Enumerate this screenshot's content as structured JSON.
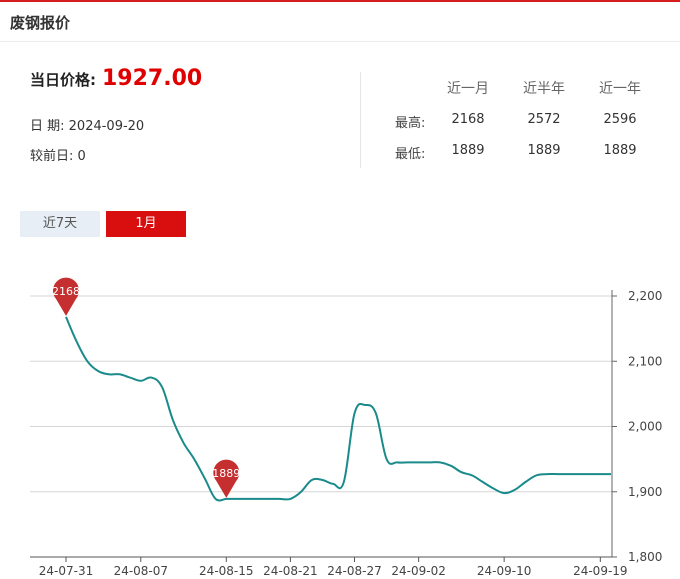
{
  "header": {
    "title": "废钢报价"
  },
  "price": {
    "label": "当日价格:",
    "value": "1927.00"
  },
  "meta": {
    "date_label": "日 期:",
    "date": "2024-09-20",
    "prev_label": "较前日:",
    "prev": "0"
  },
  "stats": {
    "headers": [
      "近一月",
      "近半年",
      "近一年"
    ],
    "high_label": "最高:",
    "low_label": "最低:",
    "high": [
      "2168",
      "2572",
      "2596"
    ],
    "low": [
      "1889",
      "1889",
      "1889"
    ]
  },
  "tabs": [
    {
      "label": "近7天",
      "active": false
    },
    {
      "label": "1月",
      "active": true
    }
  ],
  "colors": {
    "line": "#1a8a8a",
    "marker": "#c62f2f",
    "accent": "#d90e0e"
  },
  "chart_data": {
    "type": "line",
    "x": [
      "24-07-31",
      "24-08-01",
      "24-08-02",
      "24-08-03",
      "24-08-04",
      "24-08-05",
      "24-08-06",
      "24-08-07",
      "24-08-08",
      "24-08-09",
      "24-08-10",
      "24-08-11",
      "24-08-12",
      "24-08-13",
      "24-08-14",
      "24-08-15",
      "24-08-16",
      "24-08-17",
      "24-08-18",
      "24-08-19",
      "24-08-20",
      "24-08-21",
      "24-08-22",
      "24-08-23",
      "24-08-24",
      "24-08-25",
      "24-08-26",
      "24-08-27",
      "24-08-28",
      "24-08-29",
      "24-08-30",
      "24-08-31",
      "24-09-01",
      "24-09-02",
      "24-09-03",
      "24-09-04",
      "24-09-05",
      "24-09-06",
      "24-09-07",
      "24-09-08",
      "24-09-09",
      "24-09-10",
      "24-09-11",
      "24-09-12",
      "24-09-13",
      "24-09-14",
      "24-09-15",
      "24-09-16",
      "24-09-17",
      "24-09-18",
      "24-09-19",
      "24-09-20"
    ],
    "values": [
      2168,
      2130,
      2100,
      2085,
      2080,
      2080,
      2075,
      2070,
      2075,
      2060,
      2010,
      1975,
      1950,
      1920,
      1889,
      1889,
      1889,
      1889,
      1889,
      1889,
      1889,
      1889,
      1900,
      1918,
      1918,
      1912,
      1915,
      2020,
      2033,
      2020,
      1950,
      1945,
      1945,
      1945,
      1945,
      1945,
      1940,
      1930,
      1925,
      1915,
      1905,
      1898,
      1903,
      1915,
      1925,
      1927,
      1927,
      1927,
      1927,
      1927,
      1927,
      1927
    ],
    "x_tick_labels": [
      "24-07-31",
      "24-08-07",
      "24-08-15",
      "24-08-21",
      "24-08-27",
      "24-09-02",
      "24-09-10",
      "24-09-19"
    ],
    "y_tick_labels": [
      "1,800",
      "1,900",
      "2,000",
      "2,100",
      "2,200"
    ],
    "ylim": [
      1800,
      2200
    ],
    "annotations": [
      {
        "label": "2168",
        "x": "24-07-31",
        "value": 2168
      },
      {
        "label": "1889",
        "x": "24-08-15",
        "value": 1889
      }
    ],
    "grid": true,
    "y_axis_position": "right"
  }
}
